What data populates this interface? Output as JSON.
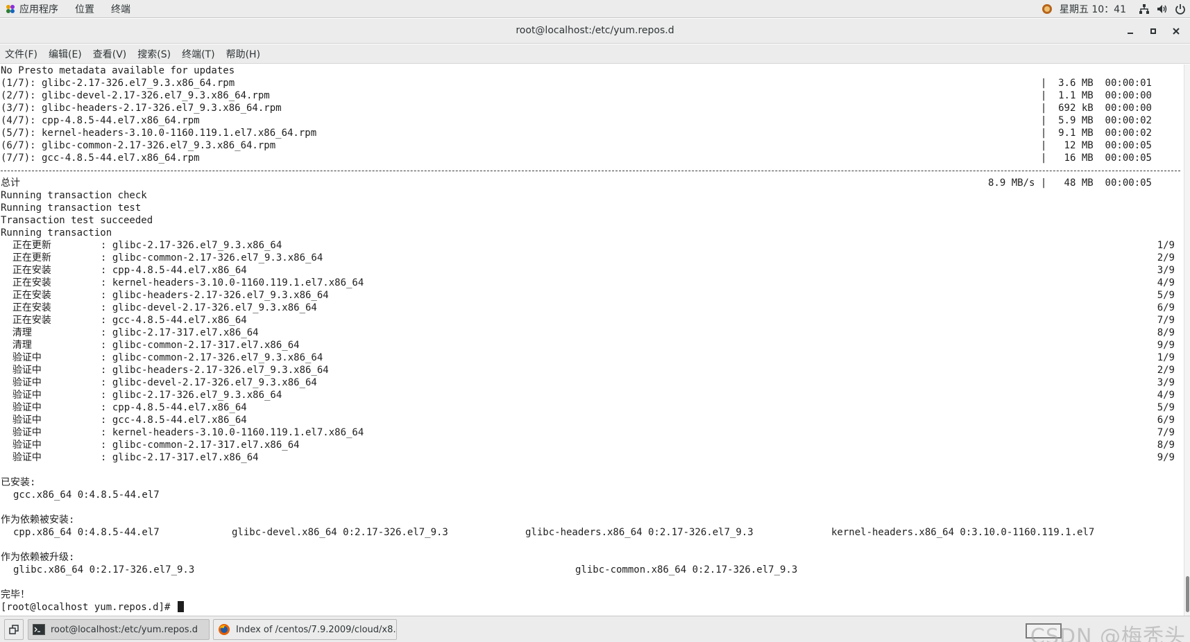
{
  "top_panel": {
    "menus": [
      "应用程序",
      "位置",
      "终端"
    ],
    "clock": "星期五 10：41",
    "icons": [
      "apps-logo-icon",
      "avatar-icon",
      "network-icon",
      "volume-icon",
      "power-icon"
    ]
  },
  "window": {
    "title": "root@localhost:/etc/yum.repos.d",
    "controls": [
      "minimize-icon",
      "maximize-icon",
      "close-icon"
    ]
  },
  "menubar": [
    "文件(F)",
    "编辑(E)",
    "查看(V)",
    "搜索(S)",
    "终端(T)",
    "帮助(H)"
  ],
  "terminal": {
    "header": "No Presto metadata available for updates",
    "downloads": [
      {
        "name": "(1/7): glibc-2.17-326.el7_9.3.x86_64.rpm",
        "stat": "|  3.6 MB  00:00:01"
      },
      {
        "name": "(2/7): glibc-devel-2.17-326.el7_9.3.x86_64.rpm",
        "stat": "|  1.1 MB  00:00:00"
      },
      {
        "name": "(3/7): glibc-headers-2.17-326.el7_9.3.x86_64.rpm",
        "stat": "|  692 kB  00:00:00"
      },
      {
        "name": "(4/7): cpp-4.8.5-44.el7.x86_64.rpm",
        "stat": "|  5.9 MB  00:00:02"
      },
      {
        "name": "(5/7): kernel-headers-3.10.0-1160.119.1.el7.x86_64.rpm",
        "stat": "|  9.1 MB  00:00:02"
      },
      {
        "name": "(6/7): glibc-common-2.17-326.el7_9.3.x86_64.rpm",
        "stat": "|   12 MB  00:00:05"
      },
      {
        "name": "(7/7): gcc-4.8.5-44.el7.x86_64.rpm",
        "stat": "|   16 MB  00:00:05"
      }
    ],
    "total": {
      "label": "总计",
      "stat": "8.9 MB/s |   48 MB  00:00:05"
    },
    "run_lines": [
      "Running transaction check",
      "Running transaction test",
      "Transaction test succeeded",
      "Running transaction"
    ],
    "transactions": [
      {
        "action": "  正在更新    ",
        "pkg": ": glibc-2.17-326.el7_9.3.x86_64",
        "progress": "1/9"
      },
      {
        "action": "  正在更新    ",
        "pkg": ": glibc-common-2.17-326.el7_9.3.x86_64",
        "progress": "2/9"
      },
      {
        "action": "  正在安装    ",
        "pkg": ": cpp-4.8.5-44.el7.x86_64",
        "progress": "3/9"
      },
      {
        "action": "  正在安装    ",
        "pkg": ": kernel-headers-3.10.0-1160.119.1.el7.x86_64",
        "progress": "4/9"
      },
      {
        "action": "  正在安装    ",
        "pkg": ": glibc-headers-2.17-326.el7_9.3.x86_64",
        "progress": "5/9"
      },
      {
        "action": "  正在安装    ",
        "pkg": ": glibc-devel-2.17-326.el7_9.3.x86_64",
        "progress": "6/9"
      },
      {
        "action": "  正在安装    ",
        "pkg": ": gcc-4.8.5-44.el7.x86_64",
        "progress": "7/9"
      },
      {
        "action": "  清理        ",
        "pkg": ": glibc-2.17-317.el7.x86_64",
        "progress": "8/9"
      },
      {
        "action": "  清理        ",
        "pkg": ": glibc-common-2.17-317.el7.x86_64",
        "progress": "9/9"
      },
      {
        "action": "  验证中      ",
        "pkg": ": glibc-common-2.17-326.el7_9.3.x86_64",
        "progress": "1/9"
      },
      {
        "action": "  验证中      ",
        "pkg": ": glibc-headers-2.17-326.el7_9.3.x86_64",
        "progress": "2/9"
      },
      {
        "action": "  验证中      ",
        "pkg": ": glibc-devel-2.17-326.el7_9.3.x86_64",
        "progress": "3/9"
      },
      {
        "action": "  验证中      ",
        "pkg": ": glibc-2.17-326.el7_9.3.x86_64",
        "progress": "4/9"
      },
      {
        "action": "  验证中      ",
        "pkg": ": cpp-4.8.5-44.el7.x86_64",
        "progress": "5/9"
      },
      {
        "action": "  验证中      ",
        "pkg": ": gcc-4.8.5-44.el7.x86_64",
        "progress": "6/9"
      },
      {
        "action": "  验证中      ",
        "pkg": ": kernel-headers-3.10.0-1160.119.1.el7.x86_64",
        "progress": "7/9"
      },
      {
        "action": "  验证中      ",
        "pkg": ": glibc-common-2.17-317.el7.x86_64",
        "progress": "8/9"
      },
      {
        "action": "  验证中      ",
        "pkg": ": glibc-2.17-317.el7.x86_64",
        "progress": "9/9"
      }
    ],
    "installed_label": "已安装:",
    "installed": [
      "gcc.x86_64 0:4.8.5-44.el7"
    ],
    "dep_installed_label": "作为依赖被安装:",
    "dep_installed": [
      "cpp.x86_64 0:4.8.5-44.el7",
      "glibc-devel.x86_64 0:2.17-326.el7_9.3",
      "glibc-headers.x86_64 0:2.17-326.el7_9.3",
      "kernel-headers.x86_64 0:3.10.0-1160.119.1.el7"
    ],
    "dep_upgraded_label": "作为依赖被升级:",
    "dep_upgraded": [
      "glibc.x86_64 0:2.17-326.el7_9.3",
      "glibc-common.x86_64 0:2.17-326.el7_9.3"
    ],
    "done": "完毕！",
    "prompt": "[root@localhost yum.repos.d]# "
  },
  "taskbar": {
    "tasks": [
      "root@localhost:/etc/yum.repos.d",
      "Index of /centos/7.9.2009/cloud/x8…"
    ],
    "watermark": "CSDN @梅秃头"
  }
}
